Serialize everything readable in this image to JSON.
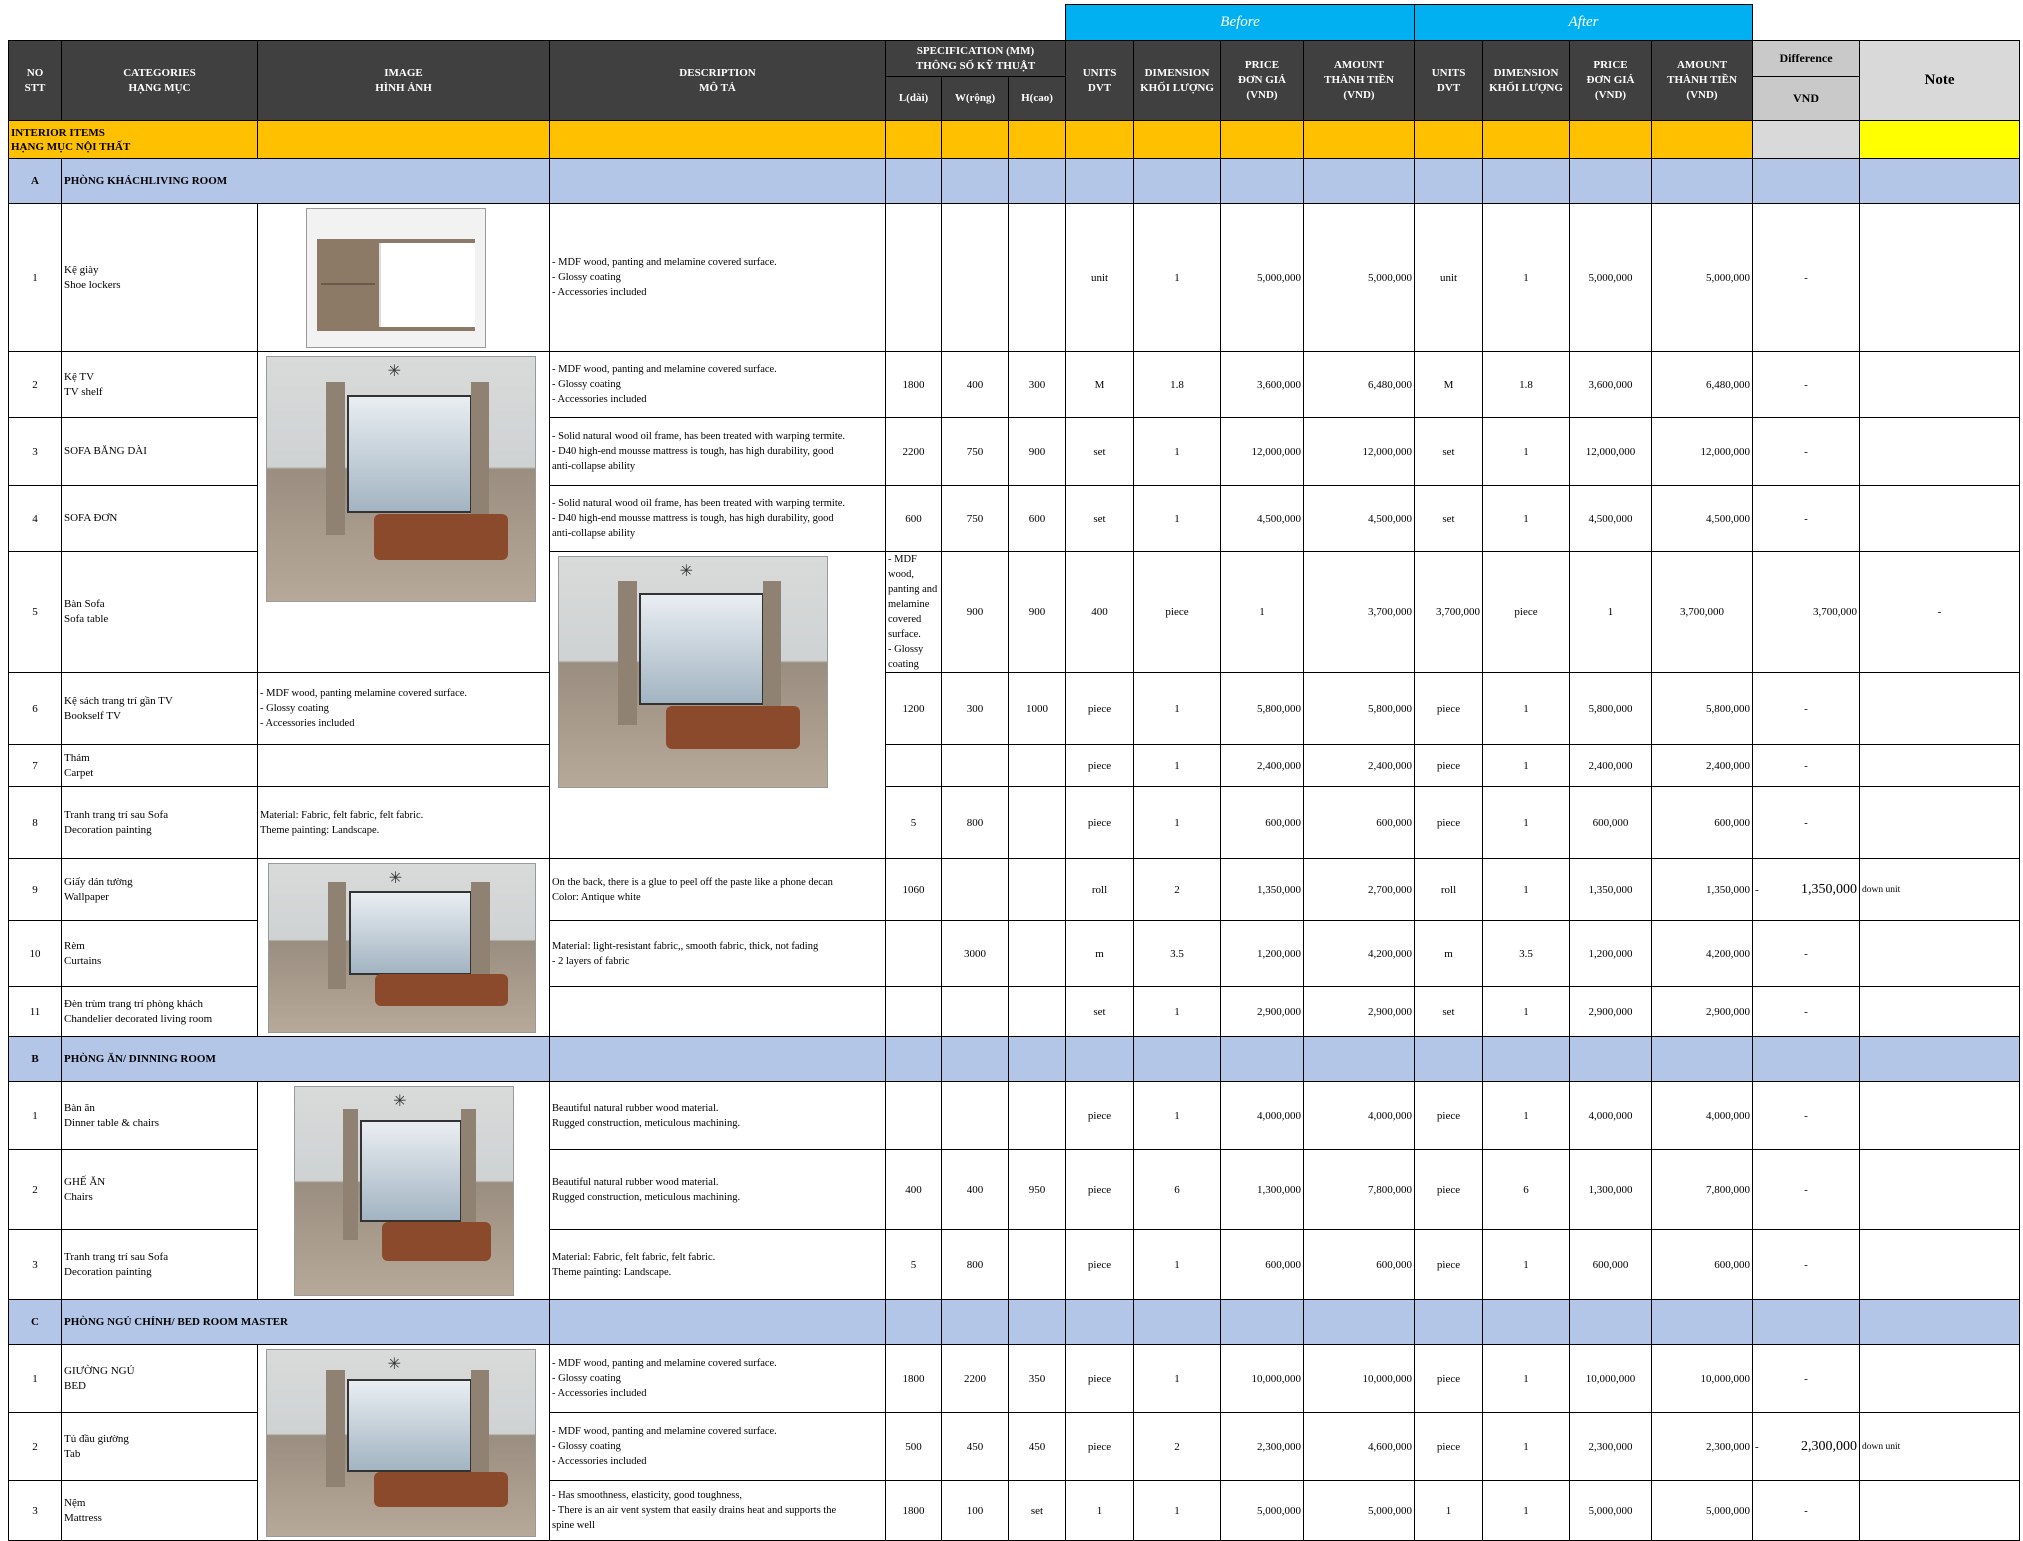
{
  "header": {
    "before": "Before",
    "after": "After",
    "no": [
      "NO",
      "STT"
    ],
    "categories": [
      "CATEGORIES",
      "HẠNG MỤC"
    ],
    "image": [
      "IMAGE",
      "HÌNH ẢNH"
    ],
    "description": [
      "DESCRIPTION",
      "MÔ TẢ"
    ],
    "specification": [
      "SPECIFICATION (MM)",
      "THÔNG SỐ KỸ THUẬT"
    ],
    "spec_l": "L(dài)",
    "spec_w": "W(rộng)",
    "spec_h": "H(cao)",
    "units": [
      "UNITS",
      "DVT"
    ],
    "dimension": [
      "DIMENSION",
      "KHỐI LƯỢNG"
    ],
    "price": [
      "PRICE",
      "ĐƠN GIÁ",
      "(VND)"
    ],
    "amount": [
      "AMOUNT",
      "THÀNH TIỀN",
      "(VND)"
    ],
    "difference": "Difference",
    "difference_unit": "VND",
    "note": "Note"
  },
  "interior": [
    "INTERIOR ITEMS",
    "HẠNG MỤC NỘI THẤT"
  ],
  "sections": [
    {
      "letter": "A",
      "title": "PHÒNG KHÁCHLIVING ROOM",
      "rows": [
        {
          "no": "1",
          "cat": [
            "Kệ giày",
            "Shoe lockers"
          ],
          "desc": [
            "- MDF wood, panting and melamine covered surface.",
            "- Glossy coating",
            "- Accessories included"
          ],
          "l": "",
          "w": "",
          "h": "",
          "bu": "unit",
          "bd": "1",
          "bp": "5,000,000",
          "ba": "5,000,000",
          "au": "unit",
          "ad": "1",
          "ap": "5,000,000",
          "aa": "5,000,000",
          "diff": "-",
          "note": ""
        },
        {
          "no": "2",
          "cat": [
            "Kệ TV",
            "TV shelf"
          ],
          "desc": [
            "- MDF wood, panting and melamine covered surface.",
            "- Glossy coating",
            "- Accessories included"
          ],
          "l": "1800",
          "w": "400",
          "h": "300",
          "bu": "M",
          "bd": "1.8",
          "bp": "3,600,000",
          "ba": "6,480,000",
          "au": "M",
          "ad": "1.8",
          "ap": "3,600,000",
          "aa": "6,480,000",
          "diff": "-",
          "note": ""
        },
        {
          "no": "3",
          "cat": [
            "SOFA BĂNG DÀI"
          ],
          "desc": [
            "- Solid natural wood oil frame, has been treated with warping termite.",
            "- D40 high-end mousse mattress is tough, has high durability, good",
            "anti-collapse ability"
          ],
          "l": "2200",
          "w": "750",
          "h": "900",
          "bu": "set",
          "bd": "1",
          "bp": "12,000,000",
          "ba": "12,000,000",
          "au": "set",
          "ad": "1",
          "ap": "12,000,000",
          "aa": "12,000,000",
          "diff": "-",
          "note": ""
        },
        {
          "no": "4",
          "cat": [
            "SOFA ĐƠN"
          ],
          "desc": [
            "- Solid natural wood oil frame, has been treated with warping termite.",
            "- D40 high-end mousse mattress is tough, has high durability, good",
            "anti-collapse ability"
          ],
          "l": "600",
          "w": "750",
          "h": "600",
          "bu": "set",
          "bd": "1",
          "bp": "4,500,000",
          "ba": "4,500,000",
          "au": "set",
          "ad": "1",
          "ap": "4,500,000",
          "aa": "4,500,000",
          "diff": "-",
          "note": ""
        },
        {
          "no": "5",
          "cat": [
            "Bàn Sofa",
            "Sofa table"
          ],
          "desc": [
            "- MDF wood, panting and melamine covered surface.",
            "- Glossy coating"
          ],
          "l": "900",
          "w": "900",
          "h": "400",
          "bu": "piece",
          "bd": "1",
          "bp": "3,700,000",
          "ba": "3,700,000",
          "au": "piece",
          "ad": "1",
          "ap": "3,700,000",
          "aa": "3,700,000",
          "diff": "-",
          "note": ""
        },
        {
          "no": "6",
          "cat": [
            "Kệ sách trang trí gần TV",
            "Bookself TV"
          ],
          "desc": [
            "- MDF  wood,  panting melamine covered surface.",
            "- Glossy coating",
            "- Accessories included"
          ],
          "l": "1200",
          "w": "300",
          "h": "1000",
          "bu": "piece",
          "bd": "1",
          "bp": "5,800,000",
          "ba": "5,800,000",
          "au": "piece",
          "ad": "1",
          "ap": "5,800,000",
          "aa": "5,800,000",
          "diff": "-",
          "note": ""
        },
        {
          "no": "7",
          "cat": [
            "Thảm",
            "Carpet"
          ],
          "desc": [],
          "l": "",
          "w": "",
          "h": "",
          "bu": "piece",
          "bd": "1",
          "bp": "2,400,000",
          "ba": "2,400,000",
          "au": "piece",
          "ad": "1",
          "ap": "2,400,000",
          "aa": "2,400,000",
          "diff": "-",
          "note": ""
        },
        {
          "no": "8",
          "cat": [
            "Tranh trang trí sau Sofa",
            "Decoration painting"
          ],
          "desc": [
            "Material: Fabric, felt fabric, felt fabric.",
            "Theme painting: Landscape."
          ],
          "l": "5",
          "w": "800",
          "h": "",
          "bu": "piece",
          "bd": "1",
          "bp": "600,000",
          "ba": "600,000",
          "au": "piece",
          "ad": "1",
          "ap": "600,000",
          "aa": "600,000",
          "diff": "-",
          "note": ""
        },
        {
          "no": "9",
          "cat": [
            "Giấy dán tường",
            "Wallpaper"
          ],
          "desc": [
            "On the back, there is a glue to peel off the paste like a phone decan",
            "Color: Antique white"
          ],
          "l": "1060",
          "w": "",
          "h": "",
          "bu": "roll",
          "bd": "2",
          "bp": "1,350,000",
          "ba": "2,700,000",
          "au": "roll",
          "ad": "1",
          "ap": "1,350,000",
          "aa": "1,350,000",
          "diff_sign": "-",
          "diff": "1,350,000",
          "note": "down unit"
        },
        {
          "no": "10",
          "cat": [
            "Rèm",
            "Curtains"
          ],
          "desc": [
            " Material: light-resistant fabric,, smooth fabric, thick, not fading",
            "- 2 layers of fabric"
          ],
          "l": "",
          "w": "3000",
          "h": "",
          "bu": "m",
          "bd": "3.5",
          "bp": "1,200,000",
          "ba": "4,200,000",
          "au": "m",
          "ad": "3.5",
          "ap": "1,200,000",
          "aa": "4,200,000",
          "diff": "-",
          "note": ""
        },
        {
          "no": "11",
          "cat": [
            "Đèn trùm trang trí  phòng khách",
            "Chandelier decorated living room"
          ],
          "desc": [],
          "l": "",
          "w": "",
          "h": "",
          "bu": "set",
          "bd": "1",
          "bp": "2,900,000",
          "ba": "2,900,000",
          "au": "set",
          "ad": "1",
          "ap": "2,900,000",
          "aa": "2,900,000",
          "diff": "-",
          "note": ""
        }
      ]
    },
    {
      "letter": "B",
      "title": "PHÒNG ĂN/ DINNING ROOM",
      "rows": [
        {
          "no": "1",
          "cat": [
            "Bàn ăn",
            "Dinner table & chairs"
          ],
          "desc": [
            "Beautiful natural rubber wood material.",
            "Rugged construction, meticulous machining."
          ],
          "l": "",
          "w": "",
          "h": "",
          "bu": "piece",
          "bd": "1",
          "bp": "4,000,000",
          "ba": "4,000,000",
          "au": "piece",
          "ad": "1",
          "ap": "4,000,000",
          "aa": "4,000,000",
          "diff": "-",
          "note": ""
        },
        {
          "no": "2",
          "cat": [
            "GHẾ ĂN",
            "Chairs"
          ],
          "desc": [
            "Beautiful natural rubber wood material.",
            "Rugged construction, meticulous machining."
          ],
          "l": "400",
          "w": "400",
          "h": "950",
          "bu": "piece",
          "bd": "6",
          "bp": "1,300,000",
          "ba": "7,800,000",
          "au": "piece",
          "ad": "6",
          "ap": "1,300,000",
          "aa": "7,800,000",
          "diff": "-",
          "note": ""
        },
        {
          "no": "3",
          "cat": [
            "Tranh trang trí sau Sofa",
            "Decoration painting"
          ],
          "desc": [
            "Material: Fabric, felt fabric, felt fabric.",
            "Theme painting: Landscape."
          ],
          "l": "5",
          "w": "800",
          "h": "",
          "bu": "piece",
          "bd": "1",
          "bp": "600,000",
          "ba": "600,000",
          "au": "piece",
          "ad": "1",
          "ap": "600,000",
          "aa": "600,000",
          "diff": "-",
          "note": ""
        }
      ]
    },
    {
      "letter": "C",
      "title": "PHÒNG NGỦ  CHÍNH/ BED ROOM MASTER",
      "rows": [
        {
          "no": "1",
          "cat": [
            "GIƯỜNG NGỦ",
            "BED"
          ],
          "desc": [
            "- MDF wood, panting and melamine covered surface.",
            "- Glossy coating",
            "- Accessories included"
          ],
          "l": "1800",
          "w": "2200",
          "h": "350",
          "bu": "piece",
          "bd": "1",
          "bp": "10,000,000",
          "ba": "10,000,000",
          "au": "piece",
          "ad": "1",
          "ap": "10,000,000",
          "aa": "10,000,000",
          "diff": "-",
          "note": ""
        },
        {
          "no": "2",
          "cat": [
            "Tủ đầu giường",
            "Tab"
          ],
          "desc": [
            "- MDF wood, panting and melamine covered surface.",
            "- Glossy coating",
            "- Accessories included"
          ],
          "l": "500",
          "w": "450",
          "h": "450",
          "bu": "piece",
          "bd": "2",
          "bp": "2,300,000",
          "ba": "4,600,000",
          "au": "piece",
          "ad": "1",
          "ap": "2,300,000",
          "aa": "2,300,000",
          "diff_sign": "-",
          "diff": "2,300,000",
          "note": "down unit"
        },
        {
          "no": "3",
          "cat": [
            "Nệm",
            "Mattress"
          ],
          "desc": [
            "- Has smoothness, elasticity, good toughness,",
            "- There is an air vent system that easily drains heat and supports the",
            "spine well"
          ],
          "l": "1800",
          "w": "100",
          "h": "set",
          "bu": "1",
          "bd": "1",
          "bp": "5,000,000",
          "ba": "5,000,000",
          "au": "1",
          "ad": "1",
          "ap": "5,000,000",
          "aa": "5,000,000",
          "diff": "-",
          "note": ""
        }
      ]
    }
  ],
  "images": [
    "shoe-locker-photo",
    "living-room-photo",
    "living-room-sofa-photo",
    "living-room-dining-photo",
    "dining-room-photo",
    "bedroom-photo"
  ]
}
